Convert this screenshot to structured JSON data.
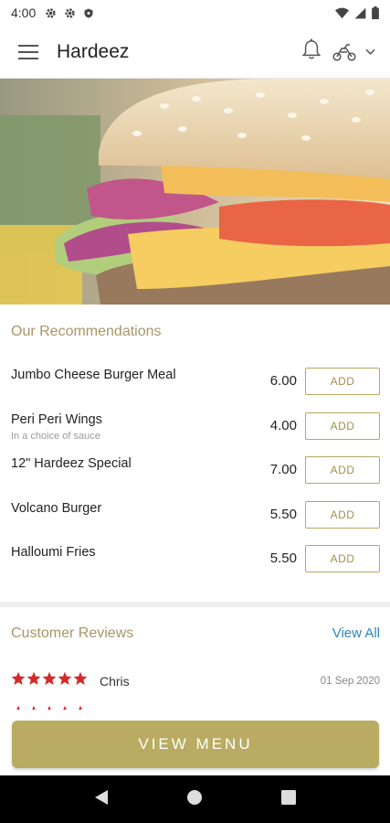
{
  "status_bar": {
    "time": "4:00",
    "icons": [
      "settings-gear-icon",
      "settings-gear-icon",
      "shield-icon",
      "wifi-icon",
      "signal-icon",
      "battery-icon"
    ]
  },
  "app_bar": {
    "title": "Hardeez",
    "icons": [
      "hamburger-menu-icon",
      "bell-icon",
      "delivery-scooter-icon",
      "chevron-down-icon"
    ]
  },
  "hero": {
    "image": "burger-photo"
  },
  "recommendations": {
    "title": "Our Recommendations",
    "add_label": "ADD",
    "items": [
      {
        "name": "Jumbo Cheese Burger Meal",
        "sub": "",
        "price": "6.00"
      },
      {
        "name": "Peri Peri Wings",
        "sub": "In a choice of sauce",
        "price": "4.00"
      },
      {
        "name": "12\" Hardeez Special",
        "sub": "",
        "price": "7.00"
      },
      {
        "name": "Volcano Burger",
        "sub": "",
        "price": "5.50"
      },
      {
        "name": "Halloumi Fries",
        "sub": "",
        "price": "5.50"
      }
    ]
  },
  "reviews": {
    "title": "Customer Reviews",
    "view_all": "View All",
    "items": [
      {
        "name": "Chris",
        "date": "01 Sep 2020",
        "rating": 5
      }
    ]
  },
  "cta": {
    "label": "VIEW MENU"
  },
  "nav_bar": {
    "icons": [
      "back-icon",
      "home-icon",
      "recents-icon"
    ]
  },
  "colors": {
    "accent_gold": "#b9ab62",
    "section_title": "#a89667",
    "link_blue": "#2f86b8",
    "star_red": "#d42a2a"
  }
}
